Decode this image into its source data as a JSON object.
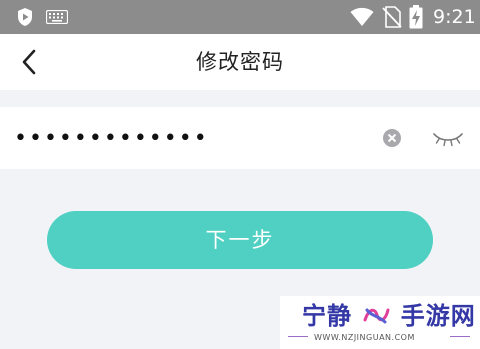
{
  "status_bar": {
    "time": "9:21",
    "icons": [
      "shield-icon",
      "keyboard-icon",
      "wifi-icon",
      "no-sim-icon",
      "battery-charging-icon"
    ]
  },
  "header": {
    "title": "修改密码",
    "back_icon": "chevron-left-icon"
  },
  "password_field": {
    "value": "•••••••••••••",
    "icons": [
      "clear-icon",
      "eye-closed-icon"
    ]
  },
  "next_button": {
    "label": "下一步"
  },
  "watermark": {
    "name_left": "宁静",
    "name_right": "手游网",
    "url": "WWW.NZJINGUAN.COM"
  },
  "colors": {
    "status_bar_bg": "#8c8c8c",
    "page_bg": "#f2f3f7",
    "accent": "#4fd0c2",
    "watermark_text": "#3338a6"
  }
}
